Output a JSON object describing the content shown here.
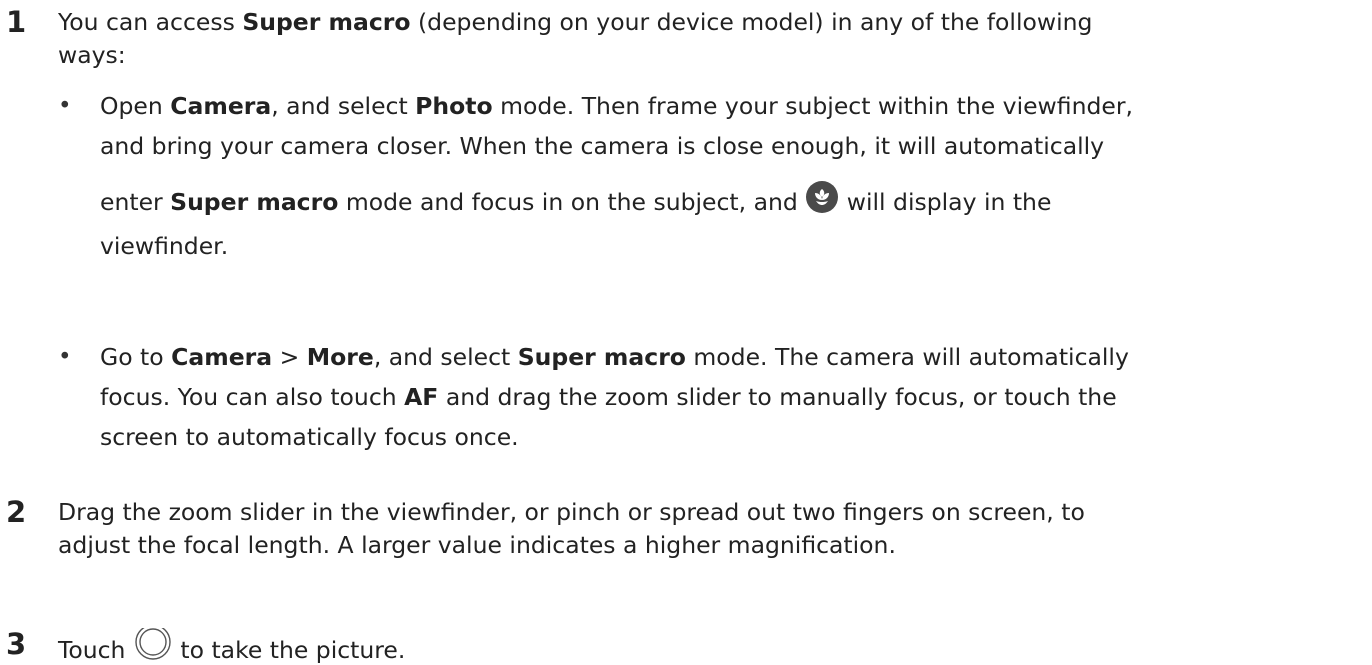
{
  "steps": [
    {
      "number": "1",
      "parts": {
        "a": "You can access ",
        "b_super_macro": "Super macro",
        "c": " (depending on your device model) in any of the following",
        "d": "ways:"
      },
      "bullets": [
        {
          "dot": "•",
          "l1a": "Open ",
          "l1b": "Camera",
          "l1c": ", and select ",
          "l1d": "Photo",
          "l1e": " mode. Then frame your subject within the viewfinder,",
          "l2": "and bring your camera closer. When the camera is close enough, it will automatically",
          "l3a": "enter ",
          "l3b": "Super macro",
          "l3c": " mode and focus in on the subject, and ",
          "l3d": " will display in the",
          "l4": "viewfinder.",
          "icon": "macro-flower-icon"
        },
        {
          "dot": "•",
          "l1a": "Go to ",
          "l1b": "Camera",
          "l1c": " > ",
          "l1d": "More",
          "l1e": ", and select ",
          "l1f": "Super macro",
          "l1g": " mode. The camera will automatically",
          "l2a": "focus. You can also touch ",
          "l2b": "AF",
          "l2c": " and drag the zoom slider to manually focus, or touch the",
          "l3": "screen to automatically focus once."
        }
      ]
    },
    {
      "number": "2",
      "l1": "Drag the zoom slider in the viewfinder, or pinch or spread out two fingers on screen, to",
      "l2": "adjust the focal length. A larger value indicates a higher magnification."
    },
    {
      "number": "3",
      "a": "Touch ",
      "b": " to take the picture.",
      "icon": "shutter-icon"
    }
  ]
}
